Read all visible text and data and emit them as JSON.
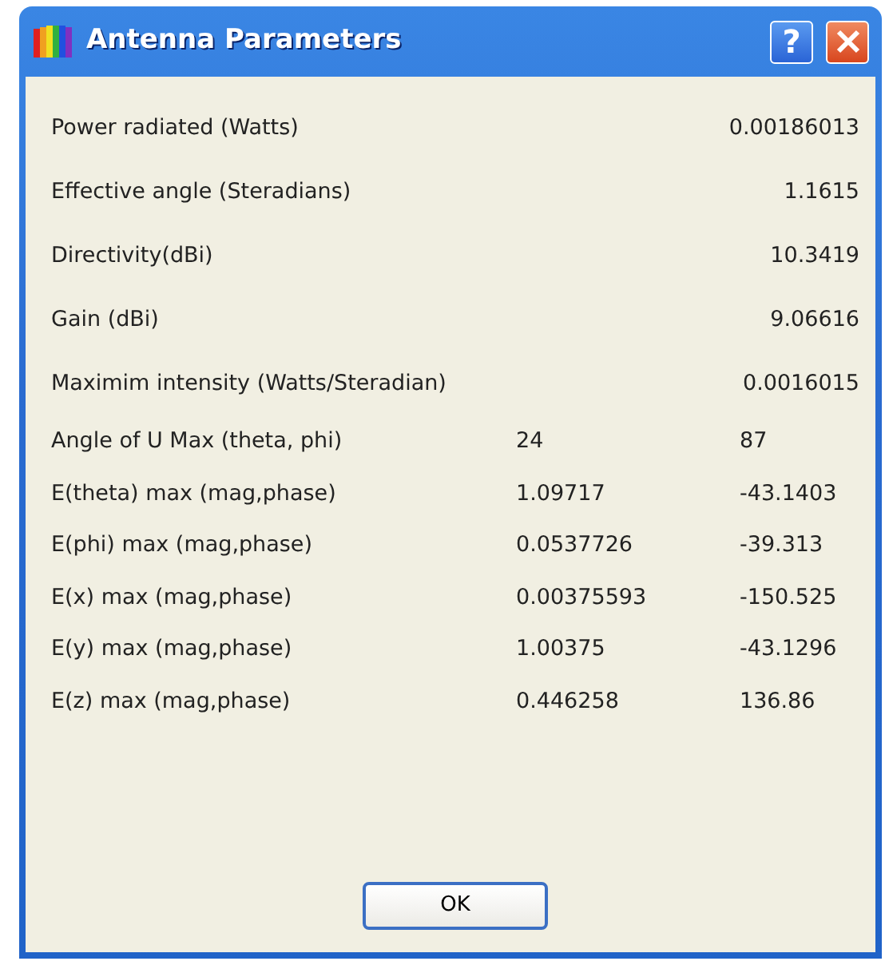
{
  "window": {
    "title": "Antenna Parameters",
    "help_button": "?"
  },
  "parameters": [
    {
      "kind": "single",
      "label": "Power radiated (Watts)",
      "value": "0.00186013"
    },
    {
      "kind": "single",
      "label": "Effective angle (Steradians)",
      "value": "1.1615"
    },
    {
      "kind": "single",
      "label": "Directivity(dBi)",
      "value": "10.3419"
    },
    {
      "kind": "single",
      "label": "Gain (dBi)",
      "value": "9.06616"
    },
    {
      "kind": "single",
      "label": "Maximim intensity (Watts/Steradian)",
      "value": "0.0016015"
    },
    {
      "kind": "pair",
      "label": "Angle of U Max (theta, phi)",
      "value_1": "24",
      "value_2": "87"
    },
    {
      "kind": "pair",
      "label": "E(theta) max (mag,phase)",
      "value_1": "1.09717",
      "value_2": "-43.1403"
    },
    {
      "kind": "pair",
      "label": "E(phi) max (mag,phase)",
      "value_1": "0.0537726",
      "value_2": "-39.313"
    },
    {
      "kind": "pair",
      "label": "E(x) max (mag,phase)",
      "value_1": "0.00375593",
      "value_2": "-150.525"
    },
    {
      "kind": "pair",
      "label": "E(y) max (mag,phase)",
      "value_1": "1.00375",
      "value_2": "-43.1296"
    },
    {
      "kind": "pair",
      "label": "E(z) max (mag,phase)",
      "value_1": "0.446258",
      "value_2": "136.86"
    }
  ],
  "buttons": [
    "OK"
  ]
}
